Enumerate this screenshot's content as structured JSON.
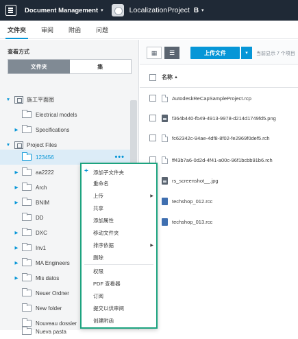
{
  "topbar": {
    "app_title": "Document Management",
    "project_name": "LocalizationProject",
    "project_badge": "B",
    "caret": "▾"
  },
  "tabs": [
    {
      "label": "文件夹",
      "active": true
    },
    {
      "label": "审阅",
      "active": false
    },
    {
      "label": "附函",
      "active": false
    },
    {
      "label": "问题",
      "active": false
    }
  ],
  "left": {
    "view_label": "查看方式",
    "segments": [
      "文件夹",
      "集"
    ],
    "tree": [
      {
        "label": "施工平面图",
        "level": 0,
        "expanded": true,
        "icon": "project-folder-icon"
      },
      {
        "label": "Electrical models",
        "level": 1,
        "expanded": null,
        "icon": "folder-icon"
      },
      {
        "label": "Specifications",
        "level": 1,
        "expanded": false,
        "icon": "folder-icon"
      },
      {
        "label": "Project Files",
        "level": 0,
        "expanded": true,
        "icon": "project-folder-icon"
      },
      {
        "label": "123456",
        "level": 1,
        "expanded": null,
        "icon": "folder-icon",
        "selected": true
      },
      {
        "label": "aa2222",
        "level": 1,
        "expanded": false,
        "icon": "folder-icon"
      },
      {
        "label": "Arch",
        "level": 1,
        "expanded": false,
        "icon": "folder-icon"
      },
      {
        "label": "BNIM",
        "level": 1,
        "expanded": false,
        "icon": "folder-icon"
      },
      {
        "label": "DD",
        "level": 1,
        "expanded": null,
        "icon": "folder-icon"
      },
      {
        "label": "DXC",
        "level": 1,
        "expanded": false,
        "icon": "folder-icon"
      },
      {
        "label": "Inv1",
        "level": 1,
        "expanded": false,
        "icon": "folder-icon"
      },
      {
        "label": "MA Engineers",
        "level": 1,
        "expanded": false,
        "icon": "folder-icon"
      },
      {
        "label": "Mis datos",
        "level": 1,
        "expanded": false,
        "icon": "folder-icon"
      },
      {
        "label": "Neuer Ordner",
        "level": 1,
        "expanded": null,
        "icon": "folder-icon"
      },
      {
        "label": "New folder",
        "level": 1,
        "expanded": null,
        "icon": "folder-icon"
      },
      {
        "label": "Nouveau dossier",
        "level": 1,
        "expanded": null,
        "icon": "folder-icon"
      },
      {
        "label": "Nueva pasta",
        "level": 1,
        "expanded": null,
        "icon": "folder-icon"
      }
    ],
    "more_label": "•••"
  },
  "right": {
    "upload_label": "上传文件",
    "showing_text": "当前显示 7 个项目",
    "name_header": "名称",
    "sort_arrow": "▲",
    "files": [
      {
        "name": "AutodeskReCapSampleProject.rcp",
        "icon": "doc"
      },
      {
        "name": "f364b440-fb49-4913-9978-d214d1749fd5.png",
        "icon": "img"
      },
      {
        "name": "fc62342c-94ae-4df8-8f02-fe2969f0def5.rch",
        "icon": "doc"
      },
      {
        "name": "ff43b7a6-0d2d-4f41-a00c-96f1bcbb91b6.rch",
        "icon": "doc"
      },
      {
        "name": "rs_screenshot__.jpg",
        "icon": "img"
      },
      {
        "name": "techshop_012.rcc",
        "icon": "rcc"
      },
      {
        "name": "techshop_013.rcc",
        "icon": "rcc"
      }
    ]
  },
  "context_menu": {
    "items": [
      {
        "label": "添加子文件夹",
        "plus": true,
        "submenu": false
      },
      {
        "label": "重命名",
        "plus": false,
        "submenu": false
      },
      {
        "label": "上传",
        "plus": false,
        "submenu": true
      },
      {
        "label": "共享",
        "plus": false,
        "submenu": false
      },
      {
        "label": "添加属性",
        "plus": false,
        "submenu": false
      },
      {
        "label": "移动文件夹",
        "plus": false,
        "submenu": false
      },
      {
        "label": "排序依据",
        "plus": false,
        "submenu": true
      },
      {
        "label": "删除",
        "plus": false,
        "submenu": false
      },
      {
        "label": "权限",
        "plus": false,
        "submenu": false
      },
      {
        "label": "PDF 查看器",
        "plus": false,
        "submenu": false
      },
      {
        "label": "订阅",
        "plus": false,
        "submenu": false
      },
      {
        "label": "提交以供审阅",
        "plus": false,
        "submenu": false
      },
      {
        "label": "创建附函",
        "plus": false,
        "submenu": false
      }
    ],
    "plus_glyph": "+",
    "submenu_glyph": "▶"
  }
}
